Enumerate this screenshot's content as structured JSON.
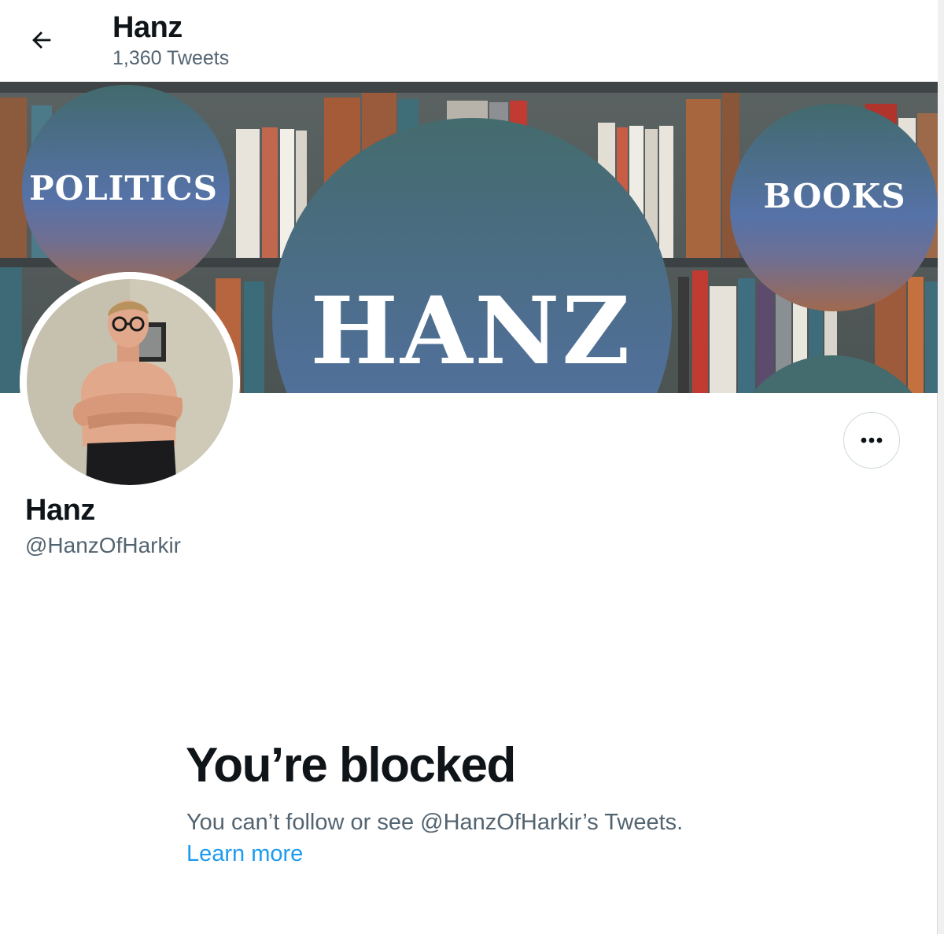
{
  "header": {
    "name": "Hanz",
    "tweet_count": "1,360 Tweets"
  },
  "banner": {
    "left_circle_text": "POLITICS",
    "center_circle_text": "HANZ",
    "right_circle_text": "BOOKS"
  },
  "profile": {
    "name": "Hanz",
    "handle": "@HanzOfHarkir"
  },
  "blocked": {
    "title": "You’re blocked",
    "description": "You can’t follow or see @HanzOfHarkir’s Tweets.",
    "learn_more": "Learn more"
  },
  "icons": {
    "back": "arrow-left-icon",
    "more": "more-horizontal-icon"
  },
  "colors": {
    "link": "#1d9bf0",
    "secondary_text": "#536471",
    "primary_text": "#0f1419",
    "banner_teal": "#456a6e",
    "banner_blue": "#5570a4",
    "banner_copper": "#9b6a55"
  }
}
